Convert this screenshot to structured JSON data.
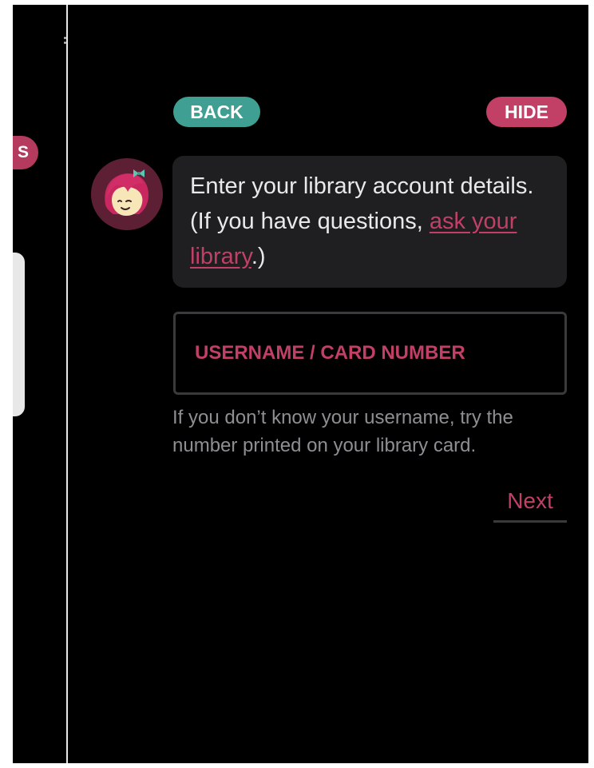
{
  "background": {
    "pill_label": "S"
  },
  "header": {
    "back_label": "BACK",
    "hide_label": "HIDE"
  },
  "message": {
    "text": "Enter your library account details. (If you have questions, ",
    "link_text": "ask your library",
    "suffix": ".)"
  },
  "form": {
    "username_placeholder": "USERNAME / CARD NUMBER",
    "username_value": "",
    "hint": "If you don’t know your username, try the number printed on your library card.",
    "next_label": "Next"
  },
  "colors": {
    "accent": "#c23f66",
    "back_button": "#3f9f92",
    "bubble": "#1f1f21",
    "hint_text": "#8e8e93"
  },
  "icons": {
    "avatar": "libby-avatar-icon"
  }
}
